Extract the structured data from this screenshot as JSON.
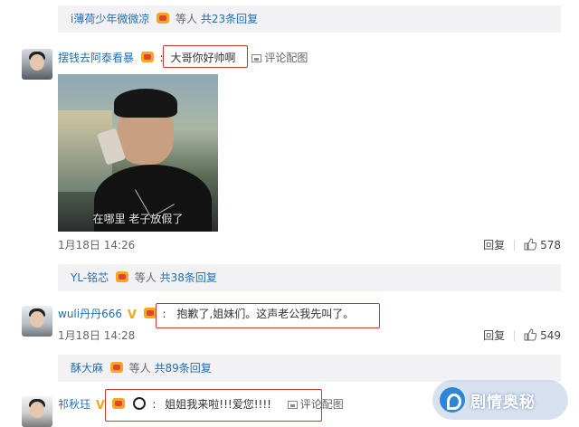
{
  "reply_bar_1": {
    "user": "i薄荷少年微微凉",
    "suffix": "等人",
    "count_text": "共23条回复"
  },
  "comment_1": {
    "username": "摆钱去阿泰看暴",
    "separator": ":",
    "text": "大哥你好帅啊",
    "pic_label": "评论配图",
    "image_caption": "在哪里 老子放假了",
    "timestamp": "1月18日 14:26",
    "reply_label": "回复",
    "likes": "578"
  },
  "reply_bar_2": {
    "user": "YL-铭芯",
    "suffix": "等人",
    "count_text": "共38条回复"
  },
  "comment_2": {
    "username": "wuli丹丹666",
    "vip_mark": "V",
    "separator": ":",
    "text": "抱歉了,姐妹们。这声老公我先叫了。",
    "timestamp": "1月18日 14:28",
    "reply_label": "回复",
    "likes": "549"
  },
  "reply_bar_3": {
    "user": "酥大麻",
    "suffix": "等人",
    "count_text": "共89条回复"
  },
  "comment_3": {
    "username": "祁秋珏",
    "vip_mark": "V",
    "separator": ":",
    "text": "姐姐我来啦!!!爱您!!!!",
    "pic_label": "评论配图"
  },
  "watermark": {
    "text": "剧情奥秘"
  },
  "colors": {
    "link": "#1f6fb2",
    "highlight_box": "#c0392b",
    "reply_bar_bg": "#f2f2f5"
  }
}
